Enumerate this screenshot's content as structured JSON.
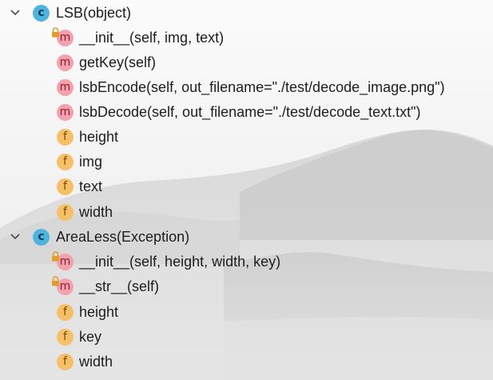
{
  "tree": {
    "classes": [
      {
        "name": "LSB(object)",
        "badge": "c",
        "members": [
          {
            "badge": "m",
            "label": "__init__(self, img, text)",
            "locked": true
          },
          {
            "badge": "m",
            "label": "getKey(self)",
            "locked": false
          },
          {
            "badge": "m",
            "label": "lsbEncode(self, out_filename=\"./test/decode_image.png\")",
            "locked": false
          },
          {
            "badge": "m",
            "label": "lsbDecode(self, out_filename=\"./test/decode_text.txt\")",
            "locked": false
          },
          {
            "badge": "f",
            "label": "height",
            "locked": false
          },
          {
            "badge": "f",
            "label": "img",
            "locked": false
          },
          {
            "badge": "f",
            "label": "text",
            "locked": false
          },
          {
            "badge": "f",
            "label": "width",
            "locked": false
          }
        ]
      },
      {
        "name": "AreaLess(Exception)",
        "badge": "c",
        "members": [
          {
            "badge": "m",
            "label": "__init__(self, height, width, key)",
            "locked": true
          },
          {
            "badge": "m",
            "label": "__str__(self)",
            "locked": true
          },
          {
            "badge": "f",
            "label": "height",
            "locked": false
          },
          {
            "badge": "f",
            "label": "key",
            "locked": false
          },
          {
            "badge": "f",
            "label": "width",
            "locked": false
          }
        ]
      }
    ]
  },
  "colors": {
    "class_badge": "#4fb4dd",
    "method_badge": "#f2a1ad",
    "field_badge": "#f5c067",
    "lock": "#e39b2a"
  }
}
